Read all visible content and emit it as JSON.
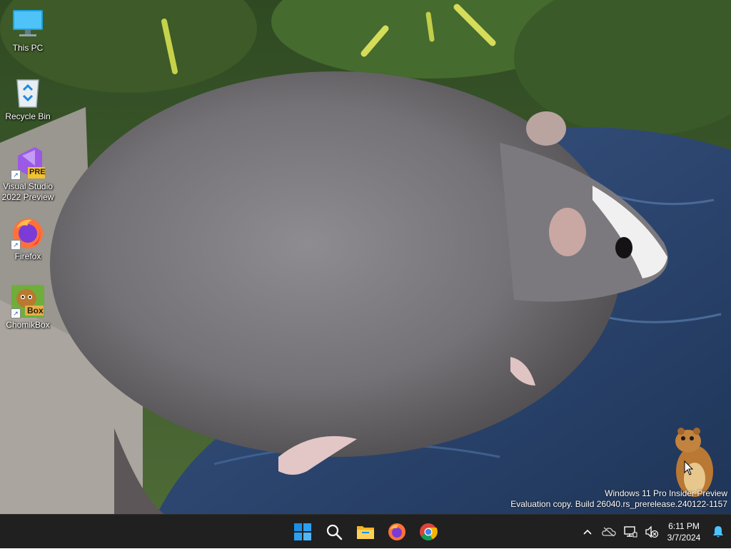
{
  "desktop": {
    "icons": [
      {
        "label": "This PC",
        "icon": "monitor-icon"
      },
      {
        "label": "Recycle Bin",
        "icon": "recycle-bin-icon"
      },
      {
        "label_line1": "Visual Studio",
        "label_line2": "2022 Preview",
        "badge": "PRE",
        "icon": "visual-studio-icon"
      },
      {
        "label": "Firefox",
        "icon": "firefox-icon"
      },
      {
        "label": "ChomikBox",
        "badge": "Box",
        "icon": "chomikbox-icon"
      }
    ],
    "wallpaper": "rat-photo-wallpaper"
  },
  "watermark": {
    "line1": "Windows 11 Pro Insider Preview",
    "line2": "Evaluation copy. Build 26040.rs_prerelease.240122-1157"
  },
  "taskbar": {
    "background": "#202020",
    "pinned": [
      "start-icon",
      "search-icon",
      "file-explorer-icon",
      "firefox-icon",
      "chrome-icon"
    ],
    "tray": {
      "icons": [
        "chevron-up-icon",
        "onedrive-icon",
        "network-icon",
        "volume-muted-icon",
        "notification-bell-icon"
      ],
      "time": "6:11 PM",
      "date": "3/7/2024"
    }
  },
  "colors": {
    "accent": "#0078d4",
    "start_blue": "#1a8fe6"
  }
}
